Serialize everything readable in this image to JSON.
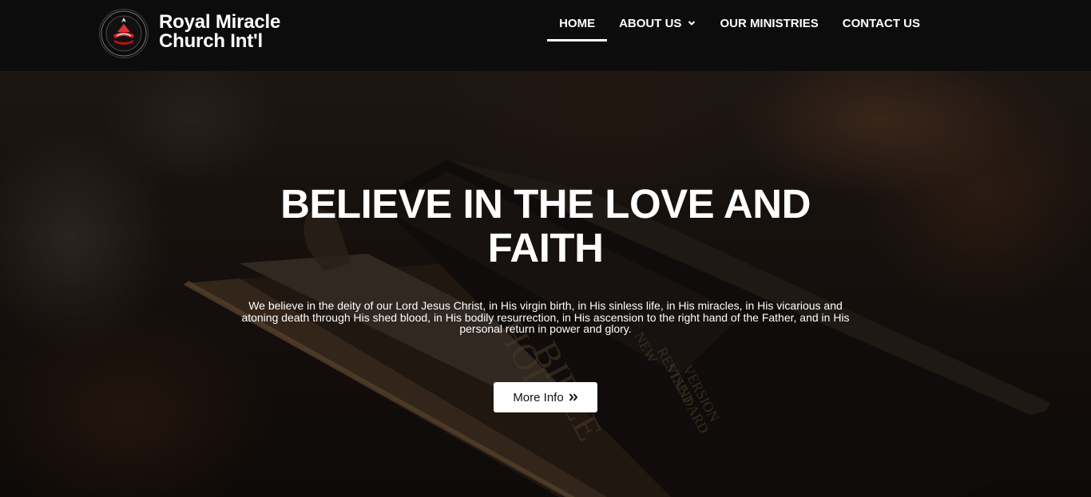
{
  "header": {
    "brand_line1": "Royal Miracle",
    "brand_line2": "Church Int'l",
    "logo_text": "ROYAL MIRACLE CHURCH INT'L"
  },
  "nav": {
    "items": [
      {
        "label": "HOME",
        "active": true
      },
      {
        "label": "ABOUT US",
        "has_dropdown": true
      },
      {
        "label": "OUR MINISTRIES"
      },
      {
        "label": "CONTACT US"
      }
    ]
  },
  "hero": {
    "title": "BELIEVE IN THE LOVE AND FAITH",
    "description": "We believe in the deity of our Lord Jesus Christ, in His virgin birth, in His sinless life, in His miracles, in His vicarious and atoning death through His shed blood, in His bodily resurrection, in His ascension to the right hand of the Father, and in His personal return in power and glory.",
    "button_label": "More Info",
    "button_icon": "double-chevron-right-icon",
    "book_spine_text": [
      "HOLY",
      "BIBLE"
    ],
    "book_subtitle": [
      "NEW",
      "REVISED",
      "STANDARD",
      "VERSION"
    ]
  },
  "colors": {
    "header_bg": "#0c0c0c",
    "overlay": "rgba(0,0,0,0.45)",
    "button_bg": "#ffffff",
    "text": "#ffffff"
  }
}
